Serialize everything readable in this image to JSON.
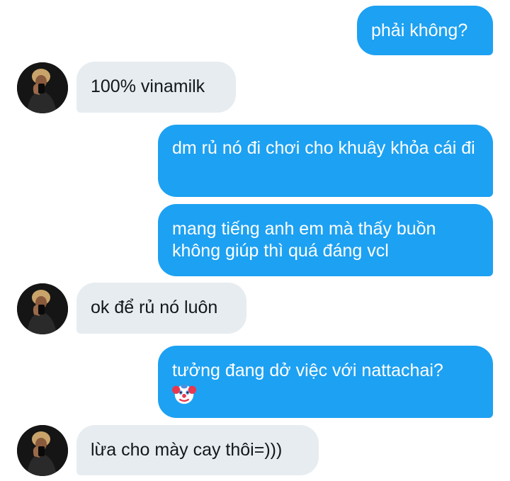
{
  "conversation": {
    "messages": [
      {
        "sender": "me",
        "text": "phải không?"
      },
      {
        "sender": "other",
        "text": "100% vinamilk"
      },
      {
        "sender": "me",
        "text": "dm rủ nó đi chơi cho khuây khỏa cái đi"
      },
      {
        "sender": "me",
        "text": "mang tiếng anh em mà thấy buồn không giúp thì quá đáng vcl"
      },
      {
        "sender": "other",
        "text": "ok để rủ nó luôn"
      },
      {
        "sender": "me",
        "text": "tưởng đang dở việc với nattachai?",
        "emoji": "clown-face-icon"
      },
      {
        "sender": "other",
        "text": "lừa cho mày cay thôi=)))"
      }
    ]
  },
  "colors": {
    "sent_bubble": "#1da1f2",
    "received_bubble": "#e6ecf0",
    "sent_text": "#ffffff",
    "received_text": "#14171a"
  }
}
